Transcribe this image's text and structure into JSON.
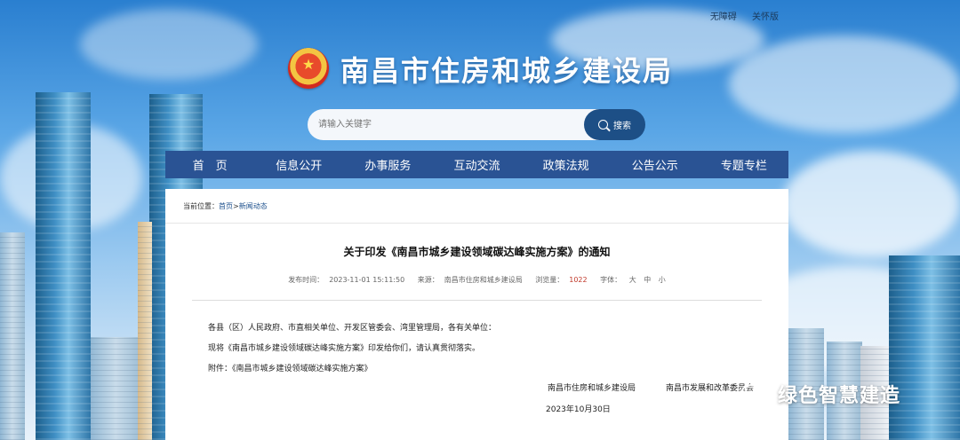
{
  "top_links": [
    "无障碍",
    "关怀版"
  ],
  "site": {
    "title": "南昌市住房和城乡建设局"
  },
  "search": {
    "placeholder": "请输入关键字",
    "button_label": "搜索"
  },
  "nav": [
    "首　页",
    "信息公开",
    "办事服务",
    "互动交流",
    "政策法规",
    "公告公示",
    "专题专栏"
  ],
  "breadcrumb": {
    "prefix": "当前位置：",
    "home": "首页",
    "sep": ">",
    "current": "新闻动态"
  },
  "article": {
    "title": "关于印发《南昌市城乡建设领域碳达峰实施方案》的通知",
    "publish_label": "发布时间：",
    "publish_time": "2023-11-01 15:11:50",
    "source_label": "来源：",
    "source": "南昌市住房和城乡建设局",
    "views_label": "浏览量：",
    "views": "1022",
    "font_label": "字体：",
    "font_sizes": [
      "大",
      "中",
      "小"
    ],
    "para1": "各县（区）人民政府、市直相关单位、开发区管委会、湾里管理局，各有关单位：",
    "para2": "现将《南昌市城乡建设领域碳达峰实施方案》印发给你们，请认真贯彻落实。",
    "para3": "附件：《南昌市城乡建设领域碳达峰实施方案》",
    "signer1": "南昌市住房和城乡建设局",
    "signer2": "南昌市发展和改革委员会",
    "date": "2023年10月30日"
  },
  "watermark": {
    "text": "绿色智慧建造",
    "icon": "wechat-icon"
  }
}
